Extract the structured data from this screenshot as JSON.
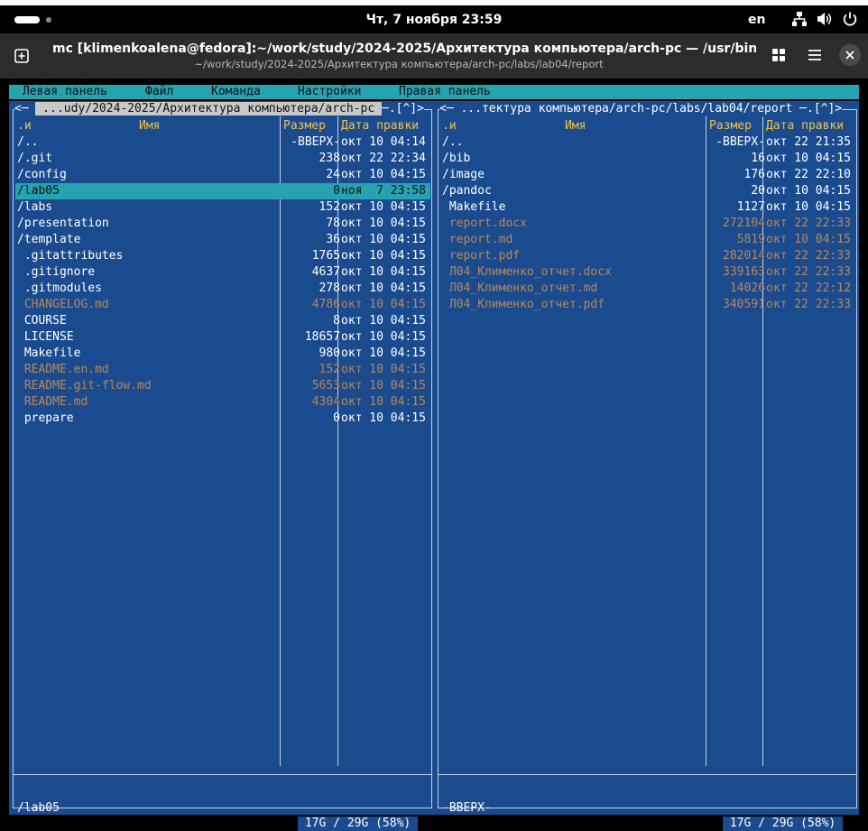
{
  "topbar": {
    "clock": "Чт, 7 ноября  23:59",
    "lang": "en"
  },
  "window": {
    "title": "mc [klimenkoalena@fedora]:~/work/study/2024-2025/Архитектура компьютера/arch-pc — /usr/bin/mc -P /var...",
    "subtitle": "~/work/study/2024-2025/Архитектура компьютера/arch-pc/labs/lab04/report"
  },
  "menu": {
    "left": "Левая панель",
    "file": "Файл",
    "command": "Команда",
    "settings": "Настройки",
    "right": "Правая панель"
  },
  "columns": {
    "name_sort": ".и",
    "name": "Имя",
    "size": "Размер",
    "date": "Дата правки"
  },
  "left_panel": {
    "title_prefix": "<─ ",
    "path": " ...udy/2024-2025/Архитектура компьютера/arch-pc ",
    "title_suffix": "─.[^]>",
    "rows": [
      {
        "name": "/..",
        "size": "-ВВЕРХ-",
        "date": "окт 10 04:14",
        "type": "dir"
      },
      {
        "name": "/.git",
        "size": "238",
        "date": "окт 22 22:34",
        "type": "dir"
      },
      {
        "name": "/config",
        "size": "24",
        "date": "окт 10 04:15",
        "type": "dir"
      },
      {
        "name": "/lab05",
        "size": "0",
        "date": "ноя  7 23:58",
        "type": "dir",
        "selected": true
      },
      {
        "name": "/labs",
        "size": "152",
        "date": "окт 10 04:15",
        "type": "dir"
      },
      {
        "name": "/presentation",
        "size": "78",
        "date": "окт 10 04:15",
        "type": "dir"
      },
      {
        "name": "/template",
        "size": "36",
        "date": "окт 10 04:15",
        "type": "dir"
      },
      {
        "name": " .gitattributes",
        "size": "1765",
        "date": "окт 10 04:15",
        "type": "file"
      },
      {
        "name": " .gitignore",
        "size": "4637",
        "date": "окт 10 04:15",
        "type": "file"
      },
      {
        "name": " .gitmodules",
        "size": "278",
        "date": "окт 10 04:15",
        "type": "file"
      },
      {
        "name": " CHANGELOG.md",
        "size": "4786",
        "date": "окт 10 04:15",
        "type": "doc"
      },
      {
        "name": " COURSE",
        "size": "8",
        "date": "окт 10 04:15",
        "type": "file"
      },
      {
        "name": " LICENSE",
        "size": "18657",
        "date": "окт 10 04:15",
        "type": "file"
      },
      {
        "name": " Makefile",
        "size": "980",
        "date": "окт 10 04:15",
        "type": "file"
      },
      {
        "name": " README.en.md",
        "size": "152",
        "date": "окт 10 04:15",
        "type": "doc"
      },
      {
        "name": " README.git-flow.md",
        "size": "5653",
        "date": "окт 10 04:15",
        "type": "doc"
      },
      {
        "name": " README.md",
        "size": "4304",
        "date": "окт 10 04:15",
        "type": "doc"
      },
      {
        "name": " prepare",
        "size": "0",
        "date": "окт 10 04:15",
        "type": "file"
      }
    ],
    "status": "/lab05",
    "free": " 17G / 29G (58%) "
  },
  "right_panel": {
    "title_prefix": "<─ ",
    "path": "...тектура компьютера/arch-pc/labs/lab04/report ",
    "title_suffix": "─.[^]>",
    "rows": [
      {
        "name": "/..",
        "size": "-ВВЕРХ-",
        "date": "окт 22 21:35",
        "type": "dir"
      },
      {
        "name": "/bib",
        "size": "16",
        "date": "окт 10 04:15",
        "type": "dir"
      },
      {
        "name": "/image",
        "size": "176",
        "date": "окт 22 22:10",
        "type": "dir"
      },
      {
        "name": "/pandoc",
        "size": "20",
        "date": "окт 10 04:15",
        "type": "dir"
      },
      {
        "name": " Makefile",
        "size": "1127",
        "date": "окт 10 04:15",
        "type": "file"
      },
      {
        "name": " report.docx",
        "size": "272104",
        "date": "окт 22 22:33",
        "type": "doc"
      },
      {
        "name": " report.md",
        "size": "5819",
        "date": "окт 10 04:15",
        "type": "doc"
      },
      {
        "name": " report.pdf",
        "size": "282014",
        "date": "окт 22 22:33",
        "type": "doc"
      },
      {
        "name": " Л04_Клименко_отчет.docx",
        "size": "339163",
        "date": "окт 22 22:33",
        "type": "doc"
      },
      {
        "name": " Л04_Клименко_отчет.md",
        "size": "14026",
        "date": "окт 22 22:12",
        "type": "doc"
      },
      {
        "name": " Л04_Клименко_отчет.pdf",
        "size": "340591",
        "date": "окт 22 22:33",
        "type": "doc"
      }
    ],
    "status": "-ВВЕРХ-",
    "free": " 17G / 29G (58%) "
  },
  "colors": {
    "panel_bg": "#1b4b8f",
    "accent": "#27a2b0",
    "header": "#f0c243",
    "doc_file": "#b8875a"
  },
  "icons": [
    "activities-indicator",
    "new-tab-icon",
    "network-icon",
    "volume-icon",
    "power-icon",
    "grid-view-icon",
    "hamburger-menu-icon",
    "close-icon"
  ]
}
